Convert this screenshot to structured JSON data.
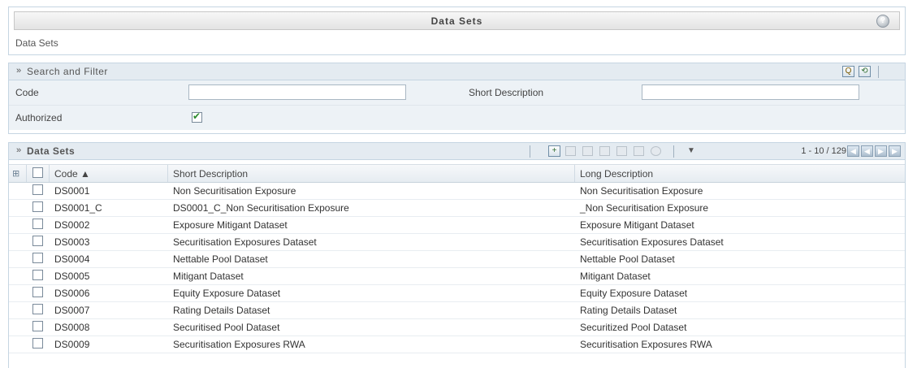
{
  "page": {
    "title": "Data Sets",
    "breadcrumb": "Data Sets",
    "help_icon": "help-icon",
    "help_glyph": "?"
  },
  "search": {
    "header": "Search and Filter",
    "toolbar_icons": [
      "search-icon",
      "reset-icon"
    ],
    "search_glyph": "Q",
    "reset_glyph": "⟲",
    "fields": {
      "code_label": "Code",
      "code_value": "",
      "short_desc_label": "Short Description",
      "short_desc_value": "",
      "authorized_label": "Authorized",
      "authorized_checked": true
    }
  },
  "grid": {
    "header": "Data Sets",
    "add_glyph": "+",
    "toolbar_icons": [
      "add-icon",
      "view-icon",
      "edit-icon",
      "copy-icon",
      "delete-icon",
      "export-icon",
      "settings-icon",
      "filter-icon"
    ],
    "pagination": "1 - 10 / 129",
    "columns": {
      "code": "Code ▲",
      "short_description": "Short Description",
      "long_description": "Long Description"
    },
    "rows": [
      {
        "code": "DS0001",
        "short": "Non Securitisation Exposure",
        "long": "Non Securitisation Exposure"
      },
      {
        "code": "DS0001_C",
        "short": "DS0001_C_Non Securitisation Exposure",
        "long": "_Non Securitisation Exposure"
      },
      {
        "code": "DS0002",
        "short": "Exposure Mitigant Dataset",
        "long": "Exposure Mitigant Dataset"
      },
      {
        "code": "DS0003",
        "short": "Securitisation Exposures Dataset",
        "long": "Securitisation Exposures Dataset"
      },
      {
        "code": "DS0004",
        "short": "Nettable Pool Dataset",
        "long": "Nettable Pool Dataset"
      },
      {
        "code": "DS0005",
        "short": "Mitigant Dataset",
        "long": "Mitigant Dataset"
      },
      {
        "code": "DS0006",
        "short": "Equity Exposure Dataset",
        "long": "Equity Exposure Dataset"
      },
      {
        "code": "DS0007",
        "short": "Rating Details Dataset",
        "long": "Rating Details Dataset"
      },
      {
        "code": "DS0008",
        "short": "Securitised Pool Dataset",
        "long": "Securitized Pool Dataset"
      },
      {
        "code": "DS0009",
        "short": "Securitisation Exposures RWA",
        "long": "Securitisation Exposures RWA"
      }
    ]
  },
  "colors": {
    "panel_border": "#c5d5e2",
    "section_header_bg": "#e4ebf1",
    "form_row_bg": "#edf2f6",
    "checkmark": "#2b8a2b"
  }
}
